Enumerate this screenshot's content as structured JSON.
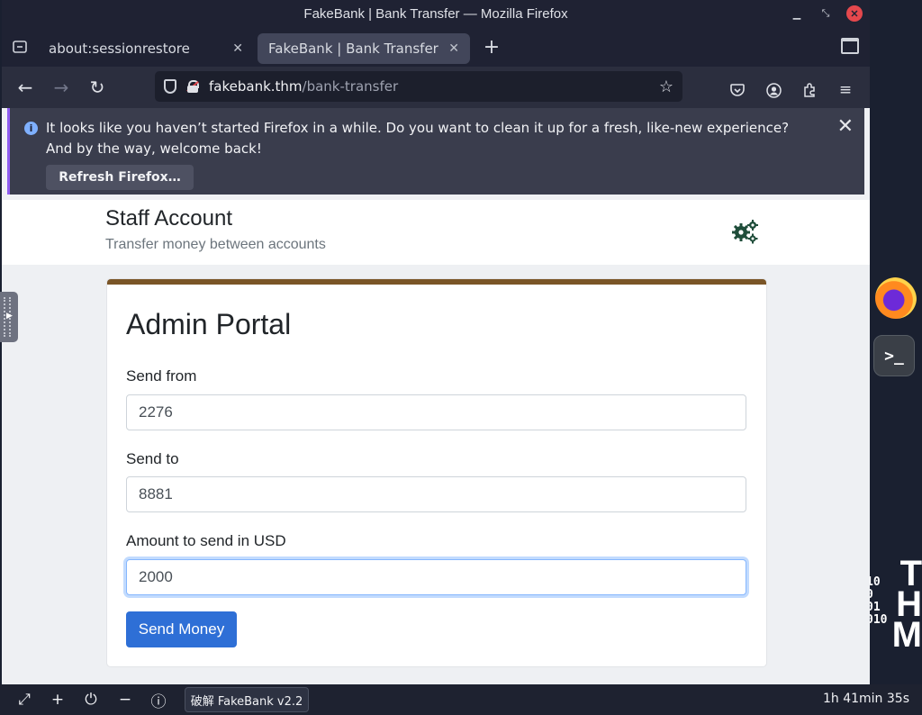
{
  "window": {
    "title": "FakeBank | Bank Transfer — Mozilla Firefox",
    "controls": [
      "minimize-icon",
      "restore-icon",
      "close-icon"
    ]
  },
  "tabs": [
    {
      "label": "about:sessionrestore",
      "active": false
    },
    {
      "label": "FakeBank | Bank Transfer",
      "active": true
    }
  ],
  "urlbar": {
    "host": "fakebank.thm",
    "path": "/bank-transfer"
  },
  "notification": {
    "message": "It looks like you haven’t started Firefox in a while. Do you want to clean it up for a fresh, like-new experience? And by the way, welcome back!",
    "button_label": "Refresh Firefox…"
  },
  "page": {
    "header_title": "Staff Account",
    "header_subtitle": "Transfer money between accounts",
    "card_title": "Admin Portal",
    "fields": [
      {
        "label": "Send from",
        "value": "2276"
      },
      {
        "label": "Send to",
        "value": "8881"
      },
      {
        "label": "Amount to send in USD",
        "value": "2000"
      }
    ],
    "submit_label": "Send Money"
  },
  "taskbar": {
    "task_label": "破解 FakeBank v2.2",
    "time_remaining": "1h 41min 35s"
  },
  "colors": {
    "card_accent": "#7a5527",
    "primary_button": "#2e6fd6",
    "gear_icon": "#1f4d3a"
  }
}
